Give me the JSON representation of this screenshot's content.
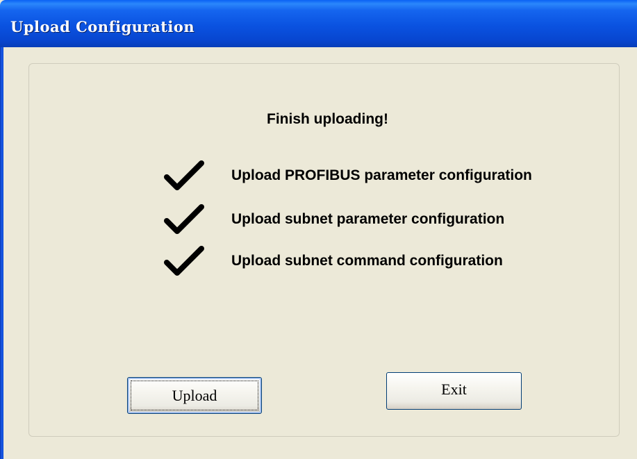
{
  "window": {
    "title": "Upload Configuration"
  },
  "status": {
    "headline": "Finish uploading!"
  },
  "steps": [
    {
      "label": "Upload PROFIBUS parameter configuration",
      "done": true,
      "icon": "checkmark-icon"
    },
    {
      "label": "Upload subnet parameter configuration",
      "done": true,
      "icon": "checkmark-icon"
    },
    {
      "label": "Upload subnet command configuration",
      "done": true,
      "icon": "checkmark-icon"
    }
  ],
  "buttons": {
    "upload_label": "Upload",
    "exit_label": "Exit"
  },
  "colors": {
    "titlebar": "#0a52e0",
    "dialog_background": "#ece9d8",
    "button_border": "#003c74"
  }
}
